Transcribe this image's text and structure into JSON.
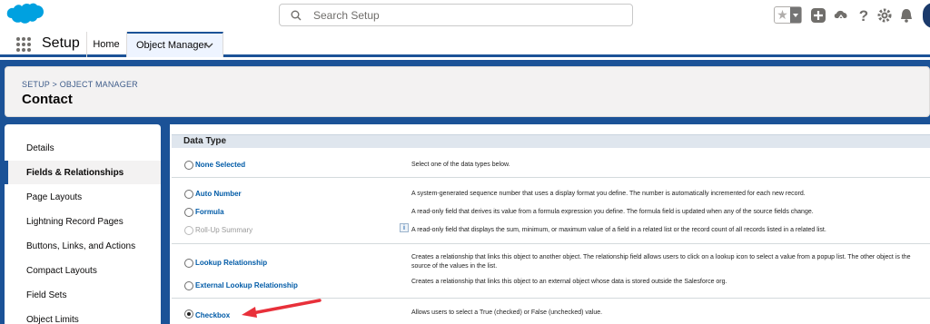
{
  "search": {
    "placeholder": "Search Setup"
  },
  "app_name": "Setup",
  "nav": {
    "home": "Home",
    "object_manager": "Object Manager"
  },
  "breadcrumb": "SETUP > OBJECT MANAGER",
  "page_title": "Contact",
  "sidebar": {
    "items": [
      {
        "label": "Details"
      },
      {
        "label": "Fields & Relationships",
        "active": true
      },
      {
        "label": "Page Layouts"
      },
      {
        "label": "Lightning Record Pages"
      },
      {
        "label": "Buttons, Links, and Actions"
      },
      {
        "label": "Compact Layouts"
      },
      {
        "label": "Field Sets"
      },
      {
        "label": "Object Limits"
      }
    ]
  },
  "section_title": "Data Type",
  "options": [
    {
      "label": "None Selected",
      "desc": "Select one of the data types below."
    },
    {
      "label": "Auto Number",
      "desc": "A system-generated sequence number that uses a display format you define. The number is automatically incremented for each new record."
    },
    {
      "label": "Formula",
      "desc": "A read-only field that derives its value from a formula expression you define. The formula field is updated when any of the source fields change."
    },
    {
      "label": "Roll-Up Summary",
      "disabled": true,
      "desc": "A read-only field that displays the sum, minimum, or maximum value of a field in a related list or the record count of all records listed in a related list."
    },
    {
      "label": "Lookup Relationship",
      "desc": "Creates a relationship that links this object to another object. The relationship field allows users to click on a lookup icon to select a value from a popup list. The other object is the source of the values in the list."
    },
    {
      "label": "External Lookup Relationship",
      "desc": "Creates a relationship that links this object to an external object whose data is stored outside the Salesforce org."
    },
    {
      "label": "Checkbox",
      "checked": true,
      "desc": "Allows users to select a True (checked) or False (unchecked) value."
    }
  ],
  "info_glyph": "i",
  "colors": {
    "brand_blue": "#1b5297",
    "link_blue": "#015ba7",
    "arrow_red": "#e8303a",
    "salesforce_cloud": "#00a1e0"
  }
}
